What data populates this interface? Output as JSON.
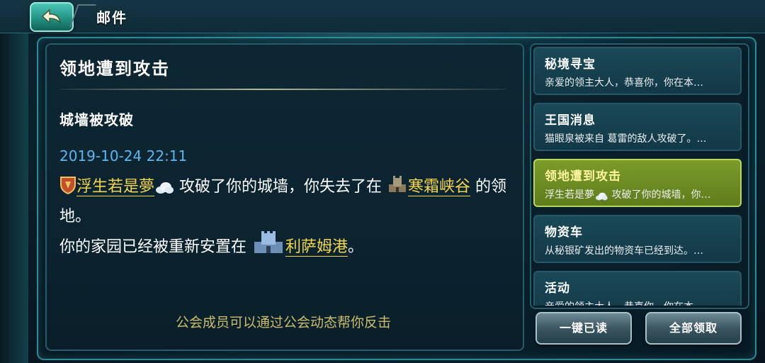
{
  "header": {
    "title": "邮件",
    "back_icon": "back-arrow-icon"
  },
  "mail": {
    "title": "领地遭到攻击",
    "subject": "城墙被攻破",
    "date": "2019-10-24 22:11",
    "body": {
      "attacker": "浮生若是夢",
      "text1": "攻破了你的城墙，你失去了在",
      "place1": "寒霜峡谷",
      "text2": "的领地。",
      "text3": "你的家园已经被重新安置在",
      "place2": "利萨姆港",
      "text4": "。"
    },
    "footer": "公会成员可以通过公会动态帮你反击"
  },
  "list": {
    "items": [
      {
        "title": "秘境寻宝",
        "preview": "亲爱的领主大人，恭喜你，你在本…"
      },
      {
        "title": "王国消息",
        "preview": "猫眼泉被来自 葛雷的敌人攻破了。…"
      },
      {
        "title": "领地遭到攻击",
        "preview": "浮生若是夢",
        "preview_rest": "攻破了你的城墙，你…",
        "selected": true
      },
      {
        "title": "物资车",
        "preview": "从秘银矿发出的物资车已经到达。…"
      },
      {
        "title": "活动",
        "preview": "亲爱的领主大人，恭喜你，你在本…"
      }
    ]
  },
  "buttons": {
    "mark_all_read": "一键已读",
    "claim_all": "全部领取"
  },
  "colors": {
    "link": "#f3d54c",
    "date": "#5eb6f0",
    "selected_item": "#7b9c2a"
  }
}
